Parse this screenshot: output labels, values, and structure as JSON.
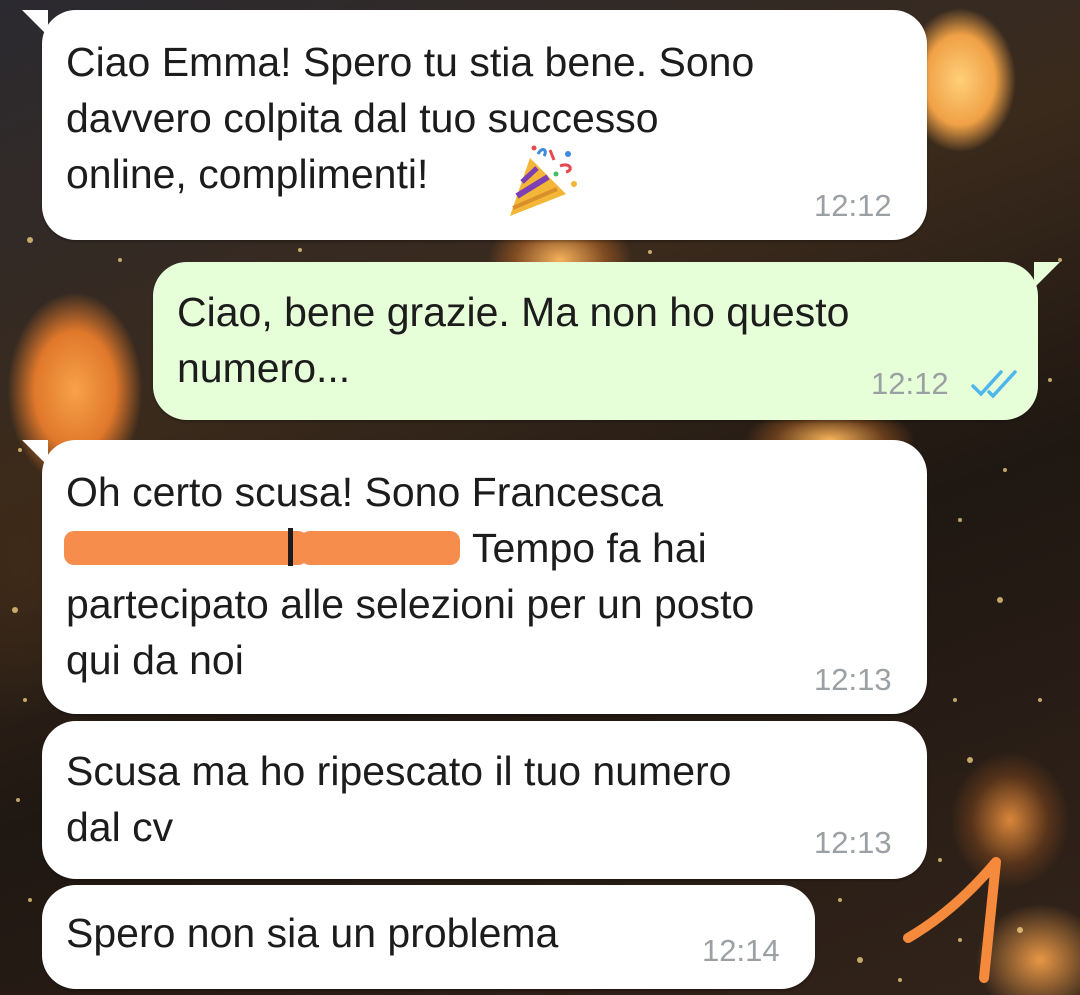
{
  "messages": [
    {
      "direction": "incoming",
      "lines": [
        "Ciao Emma! Spero tu stia bene. Sono",
        "davvero colpita dal tuo successo",
        "online, complimenti!"
      ],
      "emoji": "party-popper",
      "time": "12:12"
    },
    {
      "direction": "outgoing",
      "lines": [
        "Ciao, bene grazie. Ma non ho questo",
        "numero..."
      ],
      "time": "12:12",
      "status": "read"
    },
    {
      "direction": "incoming",
      "lines": [
        "Oh certo scusa! Sono Francesca",
        "Tempo fa hai",
        "partecipato alle selezioni per un posto",
        "qui da noi"
      ],
      "redacted": true,
      "time": "12:13"
    },
    {
      "direction": "incoming",
      "lines": [
        "Scusa ma ho ripescato il tuo numero",
        "dal cv"
      ],
      "time": "12:13"
    },
    {
      "direction": "incoming",
      "lines": [
        "Spero non sia un problema"
      ],
      "time": "12:14"
    }
  ],
  "colors": {
    "incoming_bubble": "#ffffff",
    "outgoing_bubble": "#e6ffd9",
    "read_ticks": "#4fb6ec",
    "redaction": "#f68d4d",
    "annotation": "#f68a3c"
  },
  "annotation": "hand-drawn-number-one"
}
